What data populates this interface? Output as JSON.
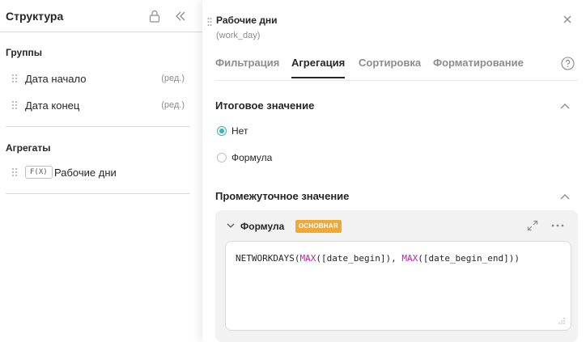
{
  "structure": {
    "title": "Структура",
    "groups_label": "Группы",
    "groups": [
      {
        "label": "Дата начало",
        "edit": "(ред.)"
      },
      {
        "label": "Дата конец",
        "edit": "(ред.)"
      }
    ],
    "aggregates_label": "Агрегаты",
    "aggregates": [
      {
        "badge": "F(X)",
        "label": "Рабочие дни"
      }
    ]
  },
  "panel": {
    "title": "Рабочие дни",
    "subtitle": "(work_day)",
    "tabs": [
      "Фильтрация",
      "Агрегация",
      "Сортировка",
      "Форматирование"
    ],
    "active_tab": "Агрегация"
  },
  "final_value": {
    "title": "Итоговое значение",
    "options": [
      {
        "label": "Нет",
        "checked": true
      },
      {
        "label": "Формула",
        "checked": false
      }
    ]
  },
  "intermediate_value": {
    "title": "Промежуточное значение",
    "formula_title": "Формула",
    "badge": "ОСНОВНАЯ",
    "code_parts": [
      {
        "text": "NETWORKDAYS(",
        "kind": "plain"
      },
      {
        "text": "MAX",
        "kind": "fn"
      },
      {
        "text": "([date_begin]), ",
        "kind": "plain"
      },
      {
        "text": "MAX",
        "kind": "fn"
      },
      {
        "text": "([date_begin_end]))",
        "kind": "plain"
      }
    ]
  },
  "colors": {
    "accent": "#3bb0b6",
    "badge": "#f0a935",
    "function": "#b5259f",
    "muted": "#8c8c8c"
  },
  "icons": [
    "lock-icon",
    "collapse-panel-icon",
    "drag-handle-icon",
    "close-icon",
    "help-icon",
    "chevron-up-icon",
    "chevron-down-icon",
    "expand-icon",
    "more-icon",
    "resize-handle-icon"
  ]
}
